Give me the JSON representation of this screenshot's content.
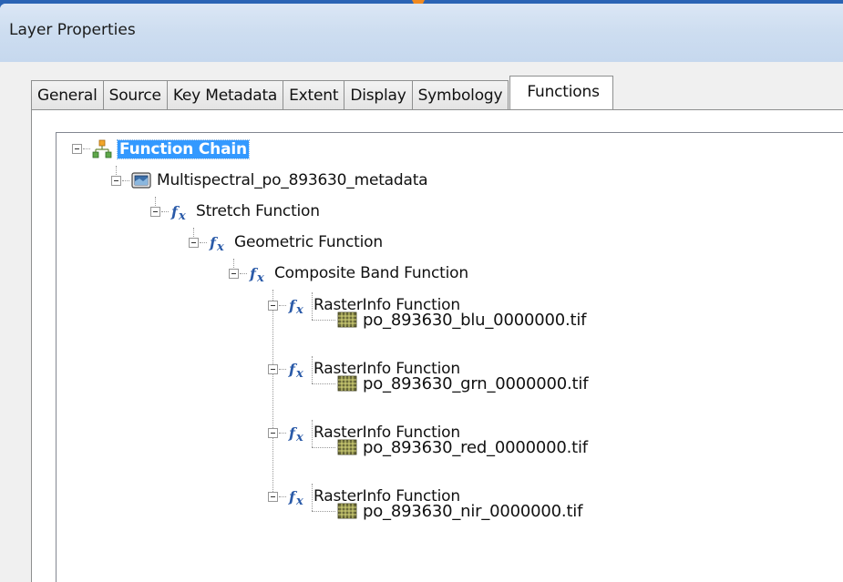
{
  "window": {
    "title": "Layer Properties"
  },
  "tabs": [
    {
      "label": "General"
    },
    {
      "label": "Source"
    },
    {
      "label": "Key Metadata"
    },
    {
      "label": "Extent"
    },
    {
      "label": "Display"
    },
    {
      "label": "Symbology"
    },
    {
      "label": "Functions",
      "active": true
    }
  ],
  "tree": {
    "root": {
      "label": "Function Chain",
      "icon": "hierarchy-icon",
      "selected": true
    },
    "raster": {
      "label": "Multispectral_po_893630_metadata",
      "icon": "raster-dataset-icon"
    },
    "stretch": {
      "label": "Stretch Function",
      "icon": "function-icon"
    },
    "geometric": {
      "label": "Geometric Function",
      "icon": "function-icon"
    },
    "composite": {
      "label": "Composite Band Function",
      "icon": "function-icon"
    },
    "bands": [
      {
        "function_label": "RasterInfo Function",
        "file_label": "po_893630_blu_0000000.tif"
      },
      {
        "function_label": "RasterInfo Function",
        "file_label": "po_893630_grn_0000000.tif"
      },
      {
        "function_label": "RasterInfo Function",
        "file_label": "po_893630_red_0000000.tif"
      },
      {
        "function_label": "RasterInfo Function",
        "file_label": "po_893630_nir_0000000.tif"
      }
    ]
  },
  "colors": {
    "selection": "#3399ff",
    "desktop": "#1d4f9c",
    "titlebar": "#cdddf0"
  }
}
